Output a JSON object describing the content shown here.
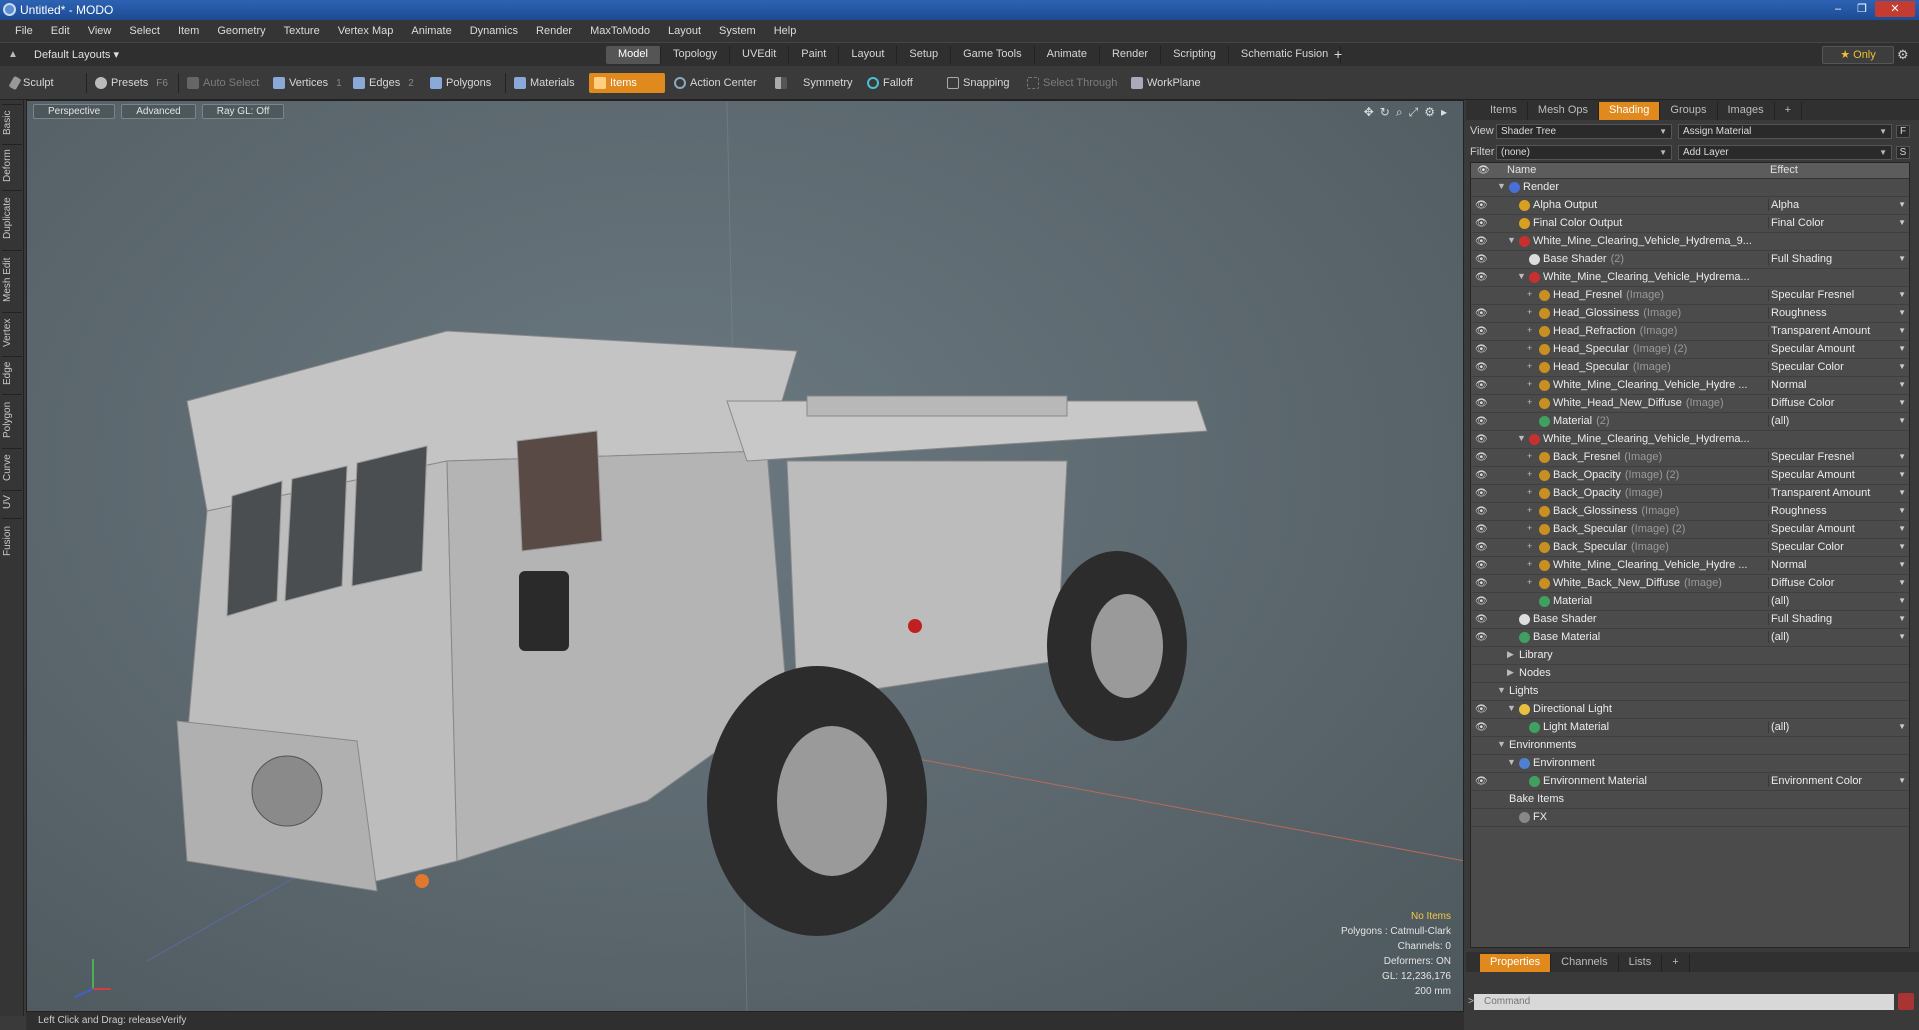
{
  "window": {
    "title": "Untitled* - MODO",
    "controls": [
      "–",
      "❐",
      "✕"
    ]
  },
  "menu": [
    "File",
    "Edit",
    "View",
    "Select",
    "Item",
    "Geometry",
    "Texture",
    "Vertex Map",
    "Animate",
    "Dynamics",
    "Render",
    "MaxToModo",
    "Layout",
    "System",
    "Help"
  ],
  "layoutbar": {
    "layout_select": "Default Layouts ▾",
    "tabs": [
      "Model",
      "Topology",
      "UVEdit",
      "Paint",
      "Layout",
      "Setup",
      "Game Tools",
      "Animate",
      "Render",
      "Scripting",
      "Schematic Fusion"
    ],
    "active_tab": "Model",
    "add": "+",
    "only": "★  Only"
  },
  "toolbar": {
    "sculpt": "Sculpt",
    "presets": "Presets",
    "presets_key": "F6",
    "auto_select": "Auto Select",
    "vertices": "Vertices",
    "vertices_key": "1",
    "edges": "Edges",
    "edges_key": "2",
    "polygons": "Polygons",
    "materials": "Materials",
    "items": "Items",
    "action_center": "Action Center",
    "symmetry": "Symmetry",
    "falloff": "Falloff",
    "snapping": "Snapping",
    "select_through": "Select Through",
    "workplane": "WorkPlane"
  },
  "left_tabs": [
    "Basic",
    "Deform",
    "Duplicate",
    "Mesh Edit",
    "Vertex",
    "Edge",
    "Polygon",
    "Curve",
    "UV",
    "Fusion"
  ],
  "viewport": {
    "perspective": "Perspective",
    "advanced": "Advanced",
    "raygl": "Ray GL: Off",
    "info": {
      "no_items": "No Items",
      "polygons": "Polygons : Catmull-Clark",
      "channels": "Channels: 0",
      "deformers": "Deformers: ON",
      "gl": "GL: 12,236,176",
      "scale": "200 mm"
    }
  },
  "right_panel": {
    "tabs": [
      "Items",
      "Mesh Ops",
      "Shading",
      "Groups",
      "Images",
      "+"
    ],
    "active_tab": "Shading",
    "view_label": "View",
    "view_value": "Shader Tree",
    "assign_material": "Assign Material",
    "f_btn": "F",
    "filter_label": "Filter",
    "filter_value": "(none)",
    "add_layer": "Add Layer",
    "s_btn": "S",
    "col_name": "Name",
    "col_effect": "Effect",
    "rows": [
      {
        "depth": 0,
        "label": "Render",
        "type": "",
        "effect": "",
        "icon": "#4a6ed8",
        "expand": "▼",
        "eye": false
      },
      {
        "depth": 1,
        "label": "Alpha Output",
        "type": "",
        "effect": "Alpha",
        "icon": "#d8a020",
        "expand": "",
        "eye": true
      },
      {
        "depth": 1,
        "label": "Final Color Output",
        "type": "",
        "effect": "Final Color",
        "icon": "#d8a020",
        "expand": "",
        "eye": true
      },
      {
        "depth": 1,
        "label": "White_Mine_Clearing_Vehicle_Hydrema_9...",
        "type": "",
        "effect": "",
        "icon": "#c83030",
        "expand": "▼",
        "eye": true
      },
      {
        "depth": 2,
        "label": "Base Shader",
        "type": "(2)",
        "effect": "Full Shading",
        "icon": "#dddddd",
        "expand": "",
        "eye": true
      },
      {
        "depth": 2,
        "label": "White_Mine_Clearing_Vehicle_Hydrema...",
        "type": "",
        "effect": "",
        "icon": "#c83030",
        "expand": "▼",
        "eye": true
      },
      {
        "depth": 3,
        "label": "Head_Fresnel",
        "type": "(Image)",
        "effect": "Specular Fresnel",
        "icon": "#c89020",
        "expand": "+",
        "eye": false
      },
      {
        "depth": 3,
        "label": "Head_Glossiness",
        "type": "(Image)",
        "effect": "Roughness",
        "icon": "#c89020",
        "expand": "+",
        "eye": true
      },
      {
        "depth": 3,
        "label": "Head_Refraction",
        "type": "(Image)",
        "effect": "Transparent Amount",
        "icon": "#c89020",
        "expand": "+",
        "eye": true
      },
      {
        "depth": 3,
        "label": "Head_Specular",
        "type": "(Image) (2)",
        "effect": "Specular Amount",
        "icon": "#c89020",
        "expand": "+",
        "eye": true
      },
      {
        "depth": 3,
        "label": "Head_Specular",
        "type": "(Image)",
        "effect": "Specular Color",
        "icon": "#c89020",
        "expand": "+",
        "eye": true
      },
      {
        "depth": 3,
        "label": "White_Mine_Clearing_Vehicle_Hydre ...",
        "type": "",
        "effect": "Normal",
        "icon": "#c89020",
        "expand": "+",
        "eye": true
      },
      {
        "depth": 3,
        "label": "White_Head_New_Diffuse",
        "type": "(Image)",
        "effect": "Diffuse Color",
        "icon": "#c89020",
        "expand": "+",
        "eye": true
      },
      {
        "depth": 3,
        "label": "Material",
        "type": "(2)",
        "effect": "(all)",
        "icon": "#40a060",
        "expand": "",
        "eye": true
      },
      {
        "depth": 2,
        "label": "White_Mine_Clearing_Vehicle_Hydrema...",
        "type": "",
        "effect": "",
        "icon": "#c83030",
        "expand": "▼",
        "eye": true
      },
      {
        "depth": 3,
        "label": "Back_Fresnel",
        "type": "(Image)",
        "effect": "Specular Fresnel",
        "icon": "#c89020",
        "expand": "+",
        "eye": true
      },
      {
        "depth": 3,
        "label": "Back_Opacity",
        "type": "(Image) (2)",
        "effect": "Specular Amount",
        "icon": "#c89020",
        "expand": "+",
        "eye": true
      },
      {
        "depth": 3,
        "label": "Back_Opacity",
        "type": "(Image)",
        "effect": "Transparent Amount",
        "icon": "#c89020",
        "expand": "+",
        "eye": true
      },
      {
        "depth": 3,
        "label": "Back_Glossiness",
        "type": "(Image)",
        "effect": "Roughness",
        "icon": "#c89020",
        "expand": "+",
        "eye": true
      },
      {
        "depth": 3,
        "label": "Back_Specular",
        "type": "(Image) (2)",
        "effect": "Specular Amount",
        "icon": "#c89020",
        "expand": "+",
        "eye": true
      },
      {
        "depth": 3,
        "label": "Back_Specular",
        "type": "(Image)",
        "effect": "Specular Color",
        "icon": "#c89020",
        "expand": "+",
        "eye": true
      },
      {
        "depth": 3,
        "label": "White_Mine_Clearing_Vehicle_Hydre ...",
        "type": "",
        "effect": "Normal",
        "icon": "#c89020",
        "expand": "+",
        "eye": true
      },
      {
        "depth": 3,
        "label": "White_Back_New_Diffuse",
        "type": "(Image)",
        "effect": "Diffuse Color",
        "icon": "#c89020",
        "expand": "+",
        "eye": true
      },
      {
        "depth": 3,
        "label": "Material",
        "type": "",
        "effect": "(all)",
        "icon": "#40a060",
        "expand": "",
        "eye": true
      },
      {
        "depth": 1,
        "label": "Base Shader",
        "type": "",
        "effect": "Full Shading",
        "icon": "#dddddd",
        "expand": "",
        "eye": true
      },
      {
        "depth": 1,
        "label": "Base Material",
        "type": "",
        "effect": "(all)",
        "icon": "#40a060",
        "expand": "",
        "eye": true
      },
      {
        "depth": 1,
        "label": "Library",
        "type": "",
        "effect": "",
        "icon": "",
        "expand": "▶",
        "eye": false
      },
      {
        "depth": 1,
        "label": "Nodes",
        "type": "",
        "effect": "",
        "icon": "",
        "expand": "▶",
        "eye": false
      },
      {
        "depth": 0,
        "label": "Lights",
        "type": "",
        "effect": "",
        "icon": "",
        "expand": "▼",
        "eye": false
      },
      {
        "depth": 1,
        "label": "Directional Light",
        "type": "",
        "effect": "",
        "icon": "#e8c040",
        "expand": "▼",
        "eye": true
      },
      {
        "depth": 2,
        "label": "Light Material",
        "type": "",
        "effect": "(all)",
        "icon": "#40a060",
        "expand": "",
        "eye": true
      },
      {
        "depth": 0,
        "label": "Environments",
        "type": "",
        "effect": "",
        "icon": "",
        "expand": "▼",
        "eye": false
      },
      {
        "depth": 1,
        "label": "Environment",
        "type": "",
        "effect": "",
        "icon": "#5080d0",
        "expand": "▼",
        "eye": false
      },
      {
        "depth": 2,
        "label": "Environment Material",
        "type": "",
        "effect": "Environment Color",
        "icon": "#40a060",
        "expand": "",
        "eye": true
      },
      {
        "depth": 0,
        "label": "Bake Items",
        "type": "",
        "effect": "",
        "icon": "",
        "expand": "",
        "eye": false
      },
      {
        "depth": 1,
        "label": "FX",
        "type": "",
        "effect": "",
        "icon": "#888888",
        "expand": "",
        "eye": false
      }
    ],
    "bottom_tabs": [
      "Properties",
      "Channels",
      "Lists",
      "+"
    ],
    "bottom_active": "Properties",
    "command_prompt": ">",
    "command_placeholder": "Command"
  },
  "status": "Left Click and Drag:   releaseVerify",
  "colors": {
    "accent": "#e08a1e",
    "titlebar": "#1d4b93"
  }
}
